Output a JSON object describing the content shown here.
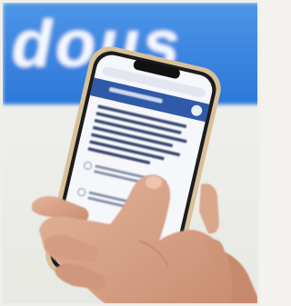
{
  "photo": {
    "banner_text": "dous",
    "colors": {
      "banner_blue": "#2d7fe0",
      "backdrop": "#f1f1ee",
      "phone_frame": "#d8c19a",
      "screen_header": "#2e5aa8",
      "skin": "#d9a58a"
    }
  }
}
